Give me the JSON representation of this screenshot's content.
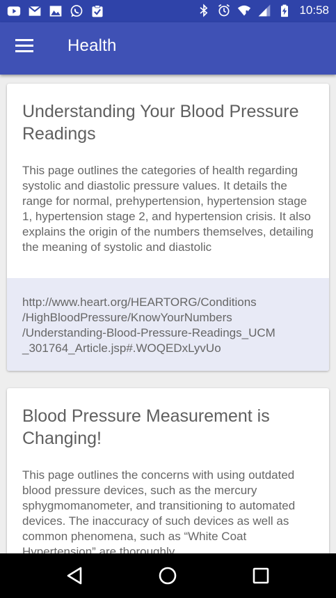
{
  "status_bar": {
    "time": "10:58",
    "left_icons": [
      "youtube-icon",
      "gmail-icon",
      "image-icon",
      "whatsapp-icon",
      "clipboard-check-icon"
    ],
    "right_icons": [
      "bluetooth-icon",
      "alarm-icon",
      "wifi-icon",
      "cell-signal-icon",
      "battery-charging-icon"
    ]
  },
  "app_bar": {
    "title": "Health",
    "menu_icon": "hamburger-menu-icon"
  },
  "cards": [
    {
      "title": "Understanding Your Blood Pressure Readings",
      "description": "This page outlines the categories of health regarding systolic and diastolic pressure values. It details the range for normal, prehypertension, hypertension stage 1, hypertension stage 2, and hypertension crisis. It also explains the origin of the numbers themselves, detailing the meaning of systolic and diastolic",
      "link_lines": [
        "http://www.heart.org/HEARTORG/Conditions",
        "/HighBloodPressure/KnowYourNumbers",
        "/Understanding-Blood-Pressure-Readings_UCM",
        "_301764_Article.jsp#.WOQEDxLyvUo"
      ]
    },
    {
      "title": "Blood Pressure Measurement is Changing!",
      "description": "This page outlines the concerns with using outdated blood pressure devices, such as the mercury sphygmomanometer, and transitioning to automated devices. The inaccuracy of such devices as well as common phenomena, such as “White Coat Hypertension” are thoroughly"
    }
  ],
  "nav_bar": {
    "buttons": [
      "back-icon",
      "home-icon",
      "recents-icon"
    ]
  },
  "colors": {
    "status_bar": "#2f43a9",
    "app_bar": "#3f51b5",
    "link_area": "#e8eaf6",
    "background": "#eeeeee"
  }
}
